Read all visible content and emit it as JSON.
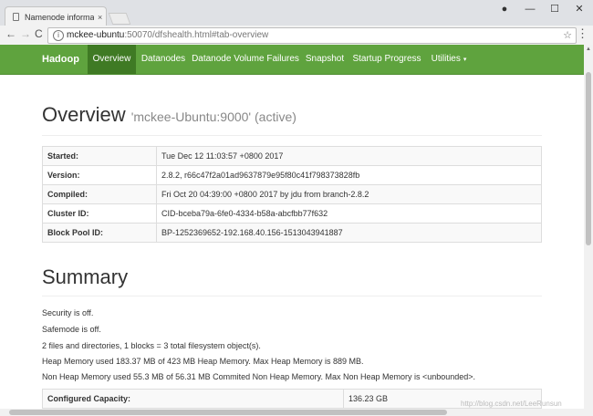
{
  "browser": {
    "tab_title": "Namenode information",
    "tab_close": "×",
    "url_host": "mckee-ubuntu",
    "url_rest": ":50070/dfshealth.html#tab-overview",
    "info_glyph": "i",
    "star_glyph": "☆",
    "menu_glyph": "⋮",
    "back_glyph": "←",
    "forward_glyph": "→",
    "reload_glyph": "C",
    "account_glyph": "●",
    "minimize_glyph": "—",
    "maximize_glyph": "☐",
    "close_glyph": "✕"
  },
  "navbar": {
    "brand": "Hadoop",
    "items": [
      {
        "label": "Overview"
      },
      {
        "label": "Datanodes"
      },
      {
        "label": "Datanode Volume Failures"
      },
      {
        "label": "Snapshot"
      },
      {
        "label": "Startup Progress"
      },
      {
        "label": "Utilities"
      }
    ],
    "caret": "▾",
    "accent": "#5fa33e",
    "active_bg": "#3f7a24"
  },
  "overview": {
    "title": "Overview",
    "subtitle": "'mckee-Ubuntu:9000' (active)",
    "rows": [
      {
        "key": "Started:",
        "value": "Tue Dec 12 11:03:57 +0800 2017"
      },
      {
        "key": "Version:",
        "value": "2.8.2, r66c47f2a01ad9637879e95f80c41f798373828fb"
      },
      {
        "key": "Compiled:",
        "value": "Fri Oct 20 04:39:00 +0800 2017 by jdu from branch-2.8.2"
      },
      {
        "key": "Cluster ID:",
        "value": "CID-bceba79a-6fe0-4334-b58a-abcfbb77f632"
      },
      {
        "key": "Block Pool ID:",
        "value": "BP-1252369652-192.168.40.156-1513043941887"
      }
    ]
  },
  "summary": {
    "title": "Summary",
    "lines": [
      "Security is off.",
      "Safemode is off.",
      "2 files and directories, 1 blocks = 3 total filesystem object(s).",
      "Heap Memory used 183.37 MB of 423 MB Heap Memory. Max Heap Memory is 889 MB.",
      "Non Heap Memory used 55.3 MB of 56.31 MB Commited Non Heap Memory. Max Non Heap Memory is <unbounded>."
    ],
    "capacity_key": "Configured Capacity:",
    "capacity_value": "136.23 GB"
  },
  "watermark": "http://blog.csdn.net/LeeRunsun"
}
